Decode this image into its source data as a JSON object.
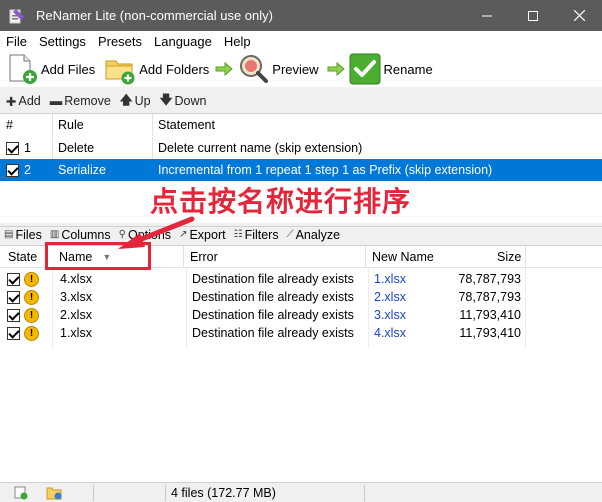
{
  "window": {
    "title": "ReNamer Lite (non-commercial use only)"
  },
  "menu": [
    "File",
    "Settings",
    "Presets",
    "Language",
    "Help"
  ],
  "toolbar": {
    "add_files": "Add Files",
    "add_folders": "Add Folders",
    "preview": "Preview",
    "rename": "Rename"
  },
  "rules_toolbar": {
    "add": "Add",
    "remove": "Remove",
    "up": "Up",
    "down": "Down"
  },
  "rules": {
    "headers": {
      "num": "#",
      "rule": "Rule",
      "statement": "Statement"
    },
    "rows": [
      {
        "num": "1",
        "rule": "Delete",
        "statement": "Delete current name (skip extension)",
        "checked": true,
        "selected": false
      },
      {
        "num": "2",
        "rule": "Serialize",
        "statement": "Incremental from 1 repeat 1 step 1 as Prefix (skip extension)",
        "checked": true,
        "selected": true
      }
    ]
  },
  "annotation": {
    "text": "点击按名称进行排序",
    "color": "#e4263a"
  },
  "files_toolbar": {
    "files": "Files",
    "columns": "Columns",
    "options": "Options",
    "export": "Export",
    "filters": "Filters",
    "analyze": "Analyze"
  },
  "files": {
    "headers": {
      "state": "State",
      "name": "Name",
      "error": "Error",
      "new_name": "New Name",
      "size": "Size"
    },
    "rows": [
      {
        "name": "4.xlsx",
        "error": "Destination file already exists",
        "new_name": "1.xlsx",
        "size": "78,787,793"
      },
      {
        "name": "3.xlsx",
        "error": "Destination file already exists",
        "new_name": "2.xlsx",
        "size": "78,787,793"
      },
      {
        "name": "2.xlsx",
        "error": "Destination file already exists",
        "new_name": "3.xlsx",
        "size": "11,793,410"
      },
      {
        "name": "1.xlsx",
        "error": "Destination file already exists",
        "new_name": "4.xlsx",
        "size": "11,793,410"
      }
    ]
  },
  "status": {
    "text": "4 files (172.77 MB)"
  },
  "colors": {
    "selection": "#0078d7",
    "titlebar": "#5b5b5b",
    "link": "#1a44c7",
    "accent_red": "#e4263a"
  }
}
